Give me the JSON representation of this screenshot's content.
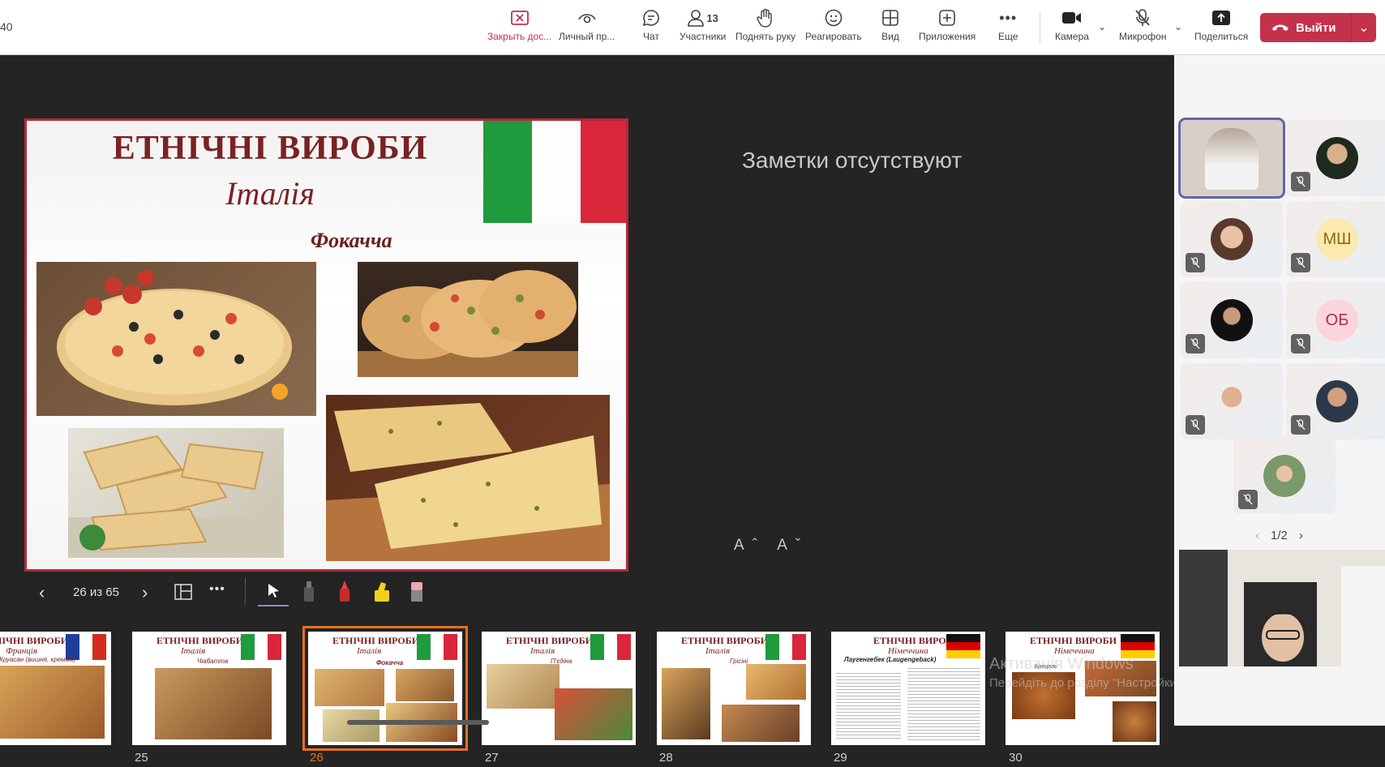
{
  "topbar": {
    "time_fragment": "40",
    "buttons": {
      "close_share": "Закрыть дос...",
      "private": "Личный пр...",
      "chat": "Чат",
      "participants": "Участники",
      "participants_count": "13",
      "raise_hand": "Поднять руку",
      "react": "Реагировать",
      "view": "Вид",
      "apps": "Приложения",
      "more": "Еще",
      "camera": "Камера",
      "mic": "Микрофон",
      "share": "Поделиться",
      "leave": "Выйти"
    },
    "colors": {
      "accent_red": "#c4314b",
      "leave_bg": "#c4314b"
    }
  },
  "slide": {
    "title": "ЕТНІЧНІ ВИРОБИ",
    "subtitle": "Італія",
    "dish": "Фокачча",
    "flag": "italy-flag"
  },
  "notes": {
    "text": "Заметки отсутствуют",
    "font_up": "Aˆ",
    "font_down": "Aˇ"
  },
  "controls": {
    "counter": "26 из 65"
  },
  "thumbnails": [
    {
      "title": "ЕТНІЧНІ ВИРОБИ",
      "subtitle": "Франція",
      "caption": "Круасан (вишня, кремом)",
      "number": "",
      "flag": "france"
    },
    {
      "title": "ЕТНІЧНІ ВИРОБИ",
      "subtitle": "Італія",
      "caption": "Чіабатта",
      "number": "25",
      "flag": "italy"
    },
    {
      "title": "ЕТНІЧНІ ВИРОБИ",
      "subtitle": "Італія",
      "caption": "Фокачча",
      "number": "26",
      "flag": "italy",
      "selected": true
    },
    {
      "title": "ЕТНІЧНІ ВИРОБИ",
      "subtitle": "Італія",
      "caption": "П'єдіна",
      "number": "27",
      "flag": "italy"
    },
    {
      "title": "ЕТНІЧНІ ВИРОБИ",
      "subtitle": "Італія",
      "caption": "Грісіні",
      "number": "28",
      "flag": "italy"
    },
    {
      "title": "ЕТНІЧНІ ВИРОБИ",
      "subtitle": "Німеччина",
      "caption": "Лаугенгебек (Laugengeback)",
      "number": "29",
      "flag": "germany"
    },
    {
      "title": "ЕТНІЧНІ ВИРОБИ",
      "subtitle": "Німеччина",
      "caption": "Брецель",
      "number": "30",
      "flag": "germany"
    }
  ],
  "watermark": {
    "line1": "Активація Windows",
    "line2": "Перейдіть до розділу \"Настройки\", щоб активувати Windows."
  },
  "participants": {
    "initials_1": "МШ",
    "initials_2": "ОБ",
    "page": "1/2"
  }
}
